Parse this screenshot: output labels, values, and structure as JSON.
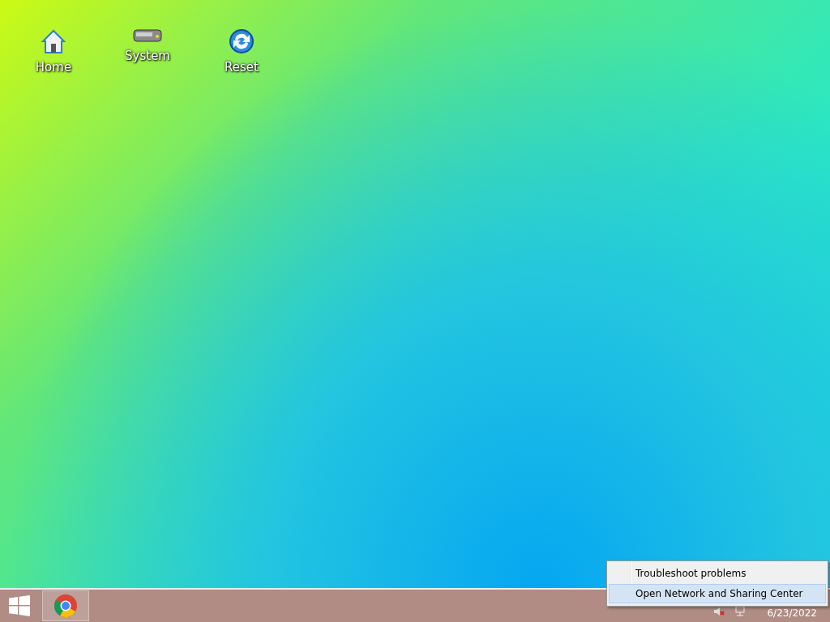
{
  "desktop_icons": [
    {
      "label": "Home",
      "kind": "home"
    },
    {
      "label": "System",
      "kind": "drive"
    },
    {
      "label": "Reset",
      "kind": "refresh"
    }
  ],
  "taskbar": {
    "pinned": [
      {
        "kind": "browser",
        "selected": true
      }
    ],
    "clock": {
      "date": "6/23/2022"
    }
  },
  "context_menu": {
    "items": [
      {
        "label": "Troubleshoot problems",
        "selected": false
      },
      {
        "label": "Open Network and Sharing Center",
        "selected": true
      }
    ]
  }
}
